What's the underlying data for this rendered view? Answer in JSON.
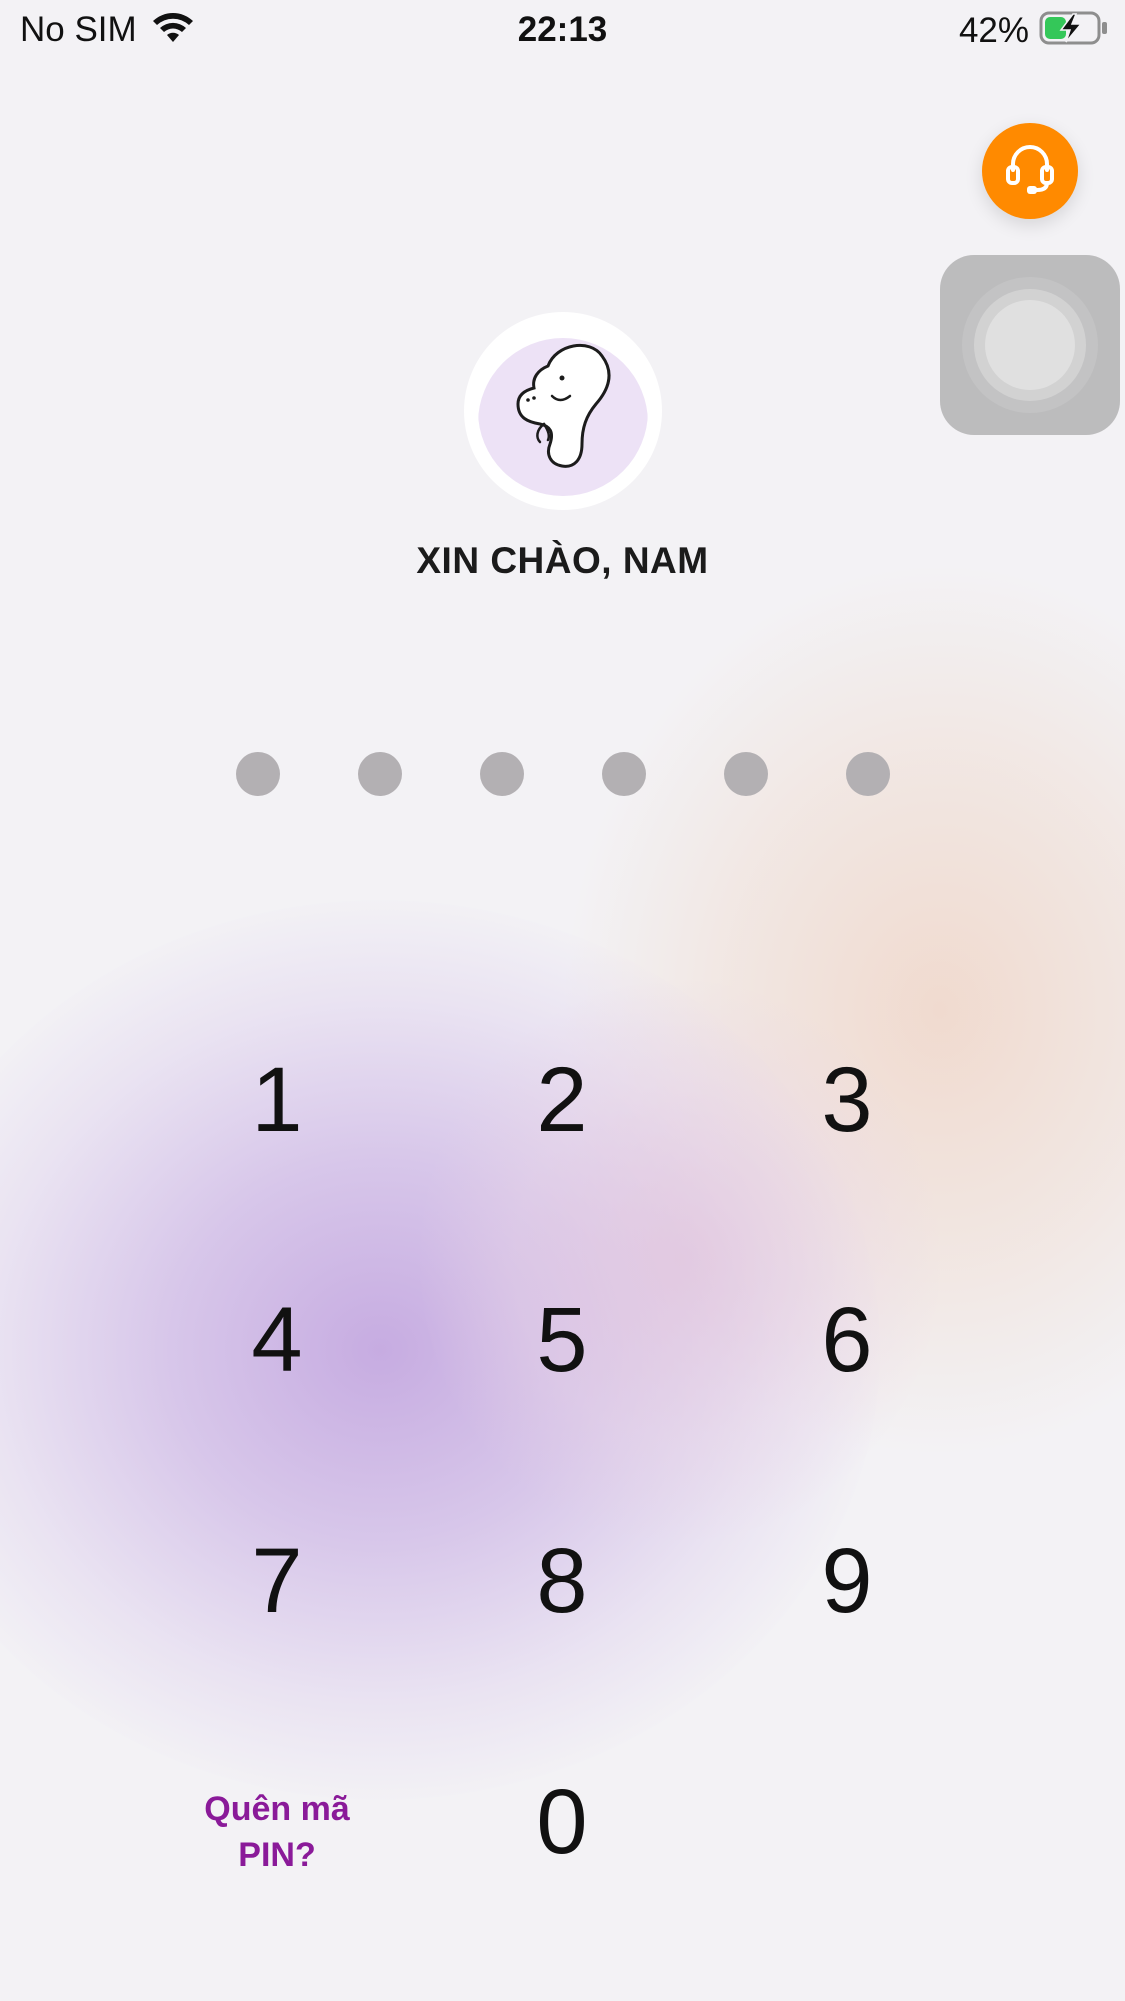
{
  "status_bar": {
    "carrier": "No SIM",
    "time": "22:13",
    "battery_percent": "42%",
    "battery_level": 0.42,
    "charging": true
  },
  "support": {
    "icon": "headset-icon",
    "color": "#ff8a00"
  },
  "assistive_touch": {
    "icon": "assistive-touch-icon"
  },
  "avatar": {
    "icon": "dinosaur-avatar-icon",
    "bg_color": "#efe3f6"
  },
  "greeting": "XIN CHÀO, NAM",
  "pin": {
    "length": 6,
    "filled": 0,
    "dot_color": "#b3b0b3"
  },
  "keypad": {
    "keys": [
      "1",
      "2",
      "3",
      "4",
      "5",
      "6",
      "7",
      "8",
      "9",
      "0"
    ],
    "forgot_line1": "Quên mã",
    "forgot_line2": "PIN?",
    "forgot_color": "#8a1a99"
  }
}
